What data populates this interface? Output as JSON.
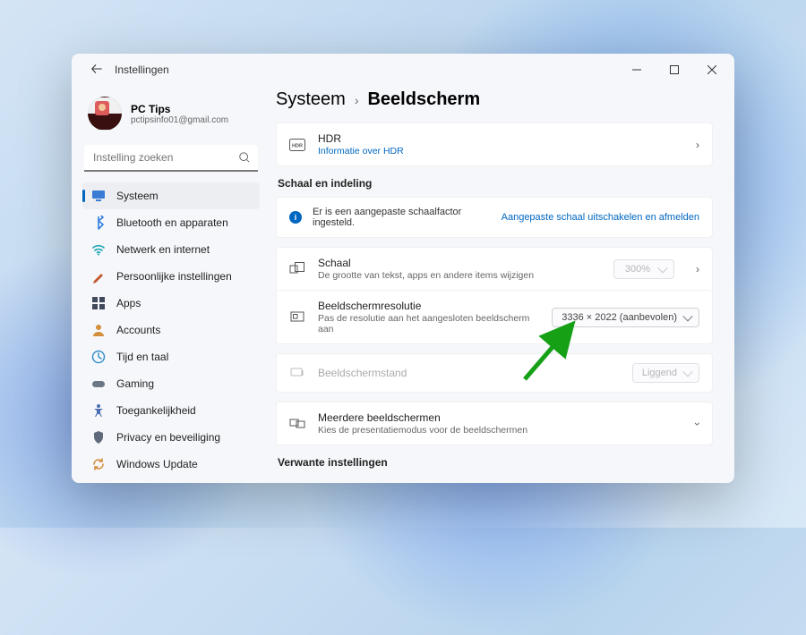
{
  "window": {
    "title": "Instellingen"
  },
  "account": {
    "name": "PC Tips",
    "email": "pctipsinfo01@gmail.com"
  },
  "search": {
    "placeholder": "Instelling zoeken"
  },
  "nav": [
    {
      "label": "Systeem",
      "icon": "system",
      "color": "#3a7bd5",
      "active": true
    },
    {
      "label": "Bluetooth en apparaten",
      "icon": "bluetooth",
      "color": "#2f7de0"
    },
    {
      "label": "Netwerk en internet",
      "icon": "network",
      "color": "#19a5b3"
    },
    {
      "label": "Persoonlijke instellingen",
      "icon": "personalize",
      "color": "#c05a2e"
    },
    {
      "label": "Apps",
      "icon": "apps",
      "color": "#414a5c"
    },
    {
      "label": "Accounts",
      "icon": "accounts",
      "color": "#d38f3e"
    },
    {
      "label": "Tijd en taal",
      "icon": "time",
      "color": "#3a90c9"
    },
    {
      "label": "Gaming",
      "icon": "gaming",
      "color": "#6b7785"
    },
    {
      "label": "Toegankelijkheid",
      "icon": "accessibility",
      "color": "#4a6fb3"
    },
    {
      "label": "Privacy en beveiliging",
      "icon": "privacy",
      "color": "#5f6b7a"
    },
    {
      "label": "Windows Update",
      "icon": "update",
      "color": "#d38f3e"
    }
  ],
  "breadcrumb": {
    "root": "Systeem",
    "page": "Beeldscherm"
  },
  "hdr": {
    "title": "HDR",
    "sub": "Informatie over HDR"
  },
  "section_scale": "Schaal en indeling",
  "info": {
    "msg": "Er is een aangepaste schaalfactor ingesteld.",
    "action": "Aangepaste schaal uitschakelen en afmelden"
  },
  "rows": {
    "scale": {
      "title": "Schaal",
      "sub": "De grootte van tekst, apps en andere items wijzigen",
      "value": "300%"
    },
    "resolution": {
      "title": "Beeldschermresolutie",
      "sub": "Pas de resolutie aan het aangesloten beeldscherm aan",
      "value": "3336 × 2022 (aanbevolen)"
    },
    "orientation": {
      "title": "Beeldschermstand",
      "value": "Liggend"
    },
    "multi": {
      "title": "Meerdere beeldschermen",
      "sub": "Kies de presentatiemodus voor de beeldschermen"
    }
  },
  "section_related": "Verwante instellingen"
}
